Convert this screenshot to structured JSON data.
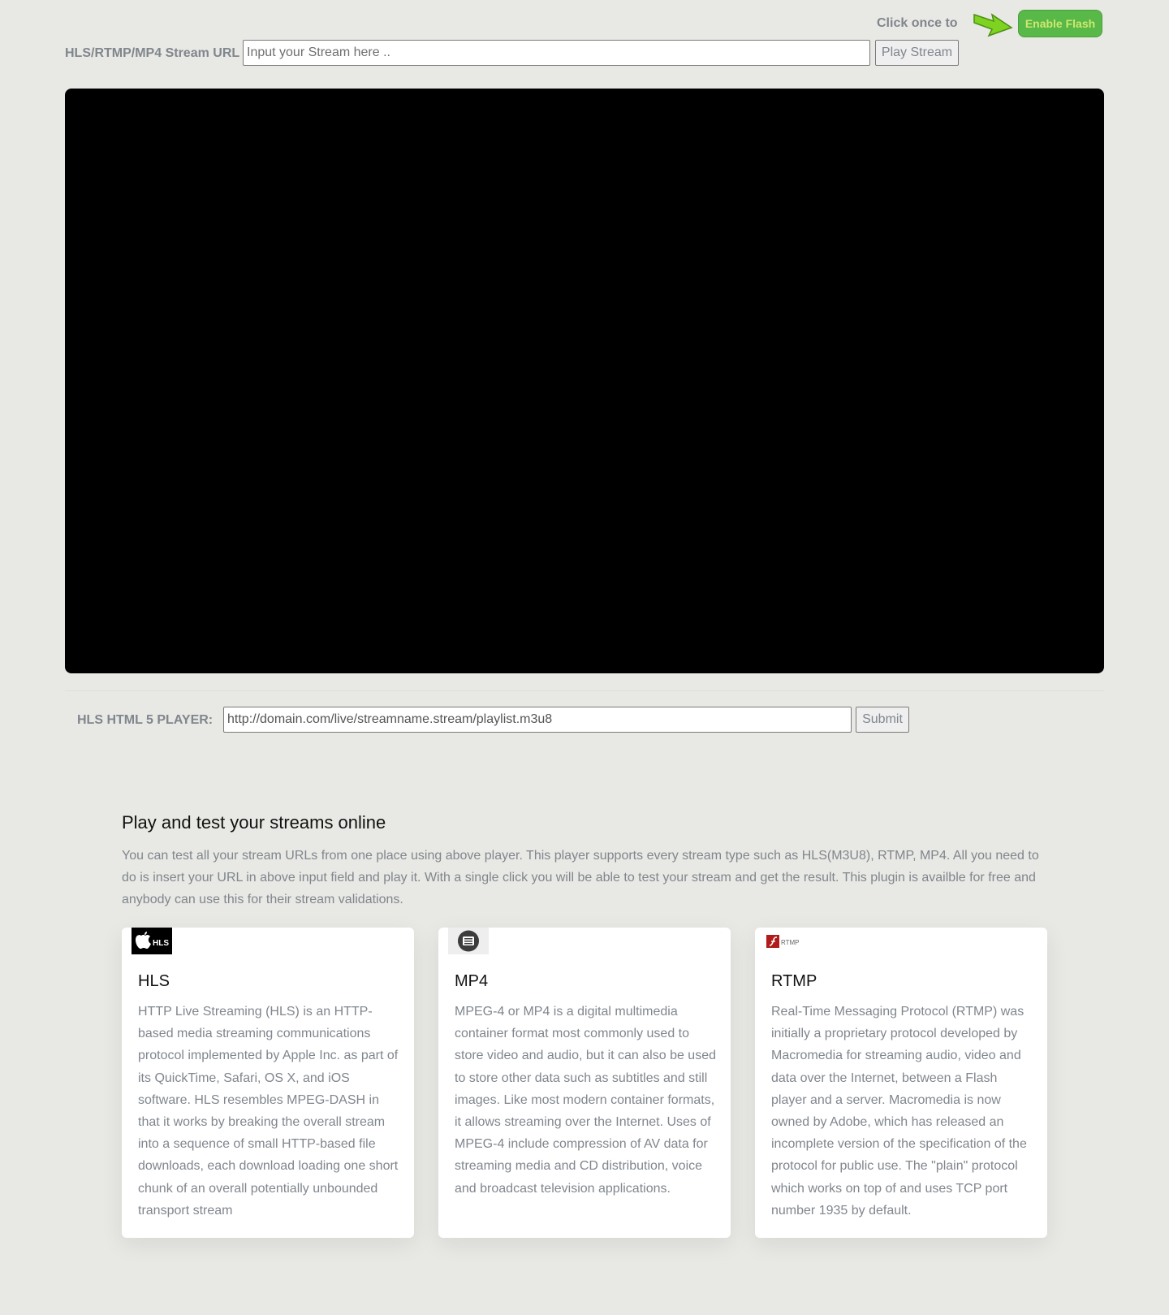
{
  "flash": {
    "prompt": "Click once to",
    "button_label": "Enable Flash",
    "arrow_icon": "arrow-right-icon"
  },
  "stream_form": {
    "label": "HLS/RTMP/MP4 Stream URL",
    "placeholder": "Input your Stream here ..",
    "button_label": "Play Stream"
  },
  "hls_form": {
    "label": "HLS HTML 5 PLAYER:",
    "value": "http://domain.com/live/streamname.stream/playlist.m3u8",
    "button_label": "Submit"
  },
  "intro": {
    "title": "Play and test your streams online",
    "text": "You can test all your stream URLs from one place using above player. This player supports every stream type such as HLS(M3U8), RTMP, MP4. All you need to do is insert your URL in above input field and play it. With a single click you will be able to test your stream and get the result. This plugin is availble for free and anybody can use this for their stream validations."
  },
  "cards": [
    {
      "logo": "hls-logo-icon",
      "logo_text": "HLS",
      "title": "HLS",
      "text": "HTTP Live Streaming (HLS) is an HTTP-based media streaming communications protocol implemented by Apple Inc. as part of its QuickTime, Safari, OS X, and iOS software. HLS resembles MPEG-DASH in that it works by breaking the overall stream into a sequence of small HTTP-based file downloads, each download loading one short chunk of an overall potentially unbounded transport stream"
    },
    {
      "logo": "mp4-logo-icon",
      "title": "MP4",
      "text": "MPEG-4 or MP4 is a digital multimedia container format most commonly used to store video and audio, but it can also be used to store other data such as subtitles and still images. Like most modern container formats, it allows streaming over the Internet. Uses of MPEG-4 include compression of AV data for streaming media and CD distribution, voice and broadcast television applications."
    },
    {
      "logo": "rtmp-logo-icon",
      "logo_text": "RTMP",
      "title": "RTMP",
      "text": "Real-Time Messaging Protocol (RTMP) was initially a proprietary protocol developed by Macromedia for streaming audio, video and data over the Internet, between a Flash player and a server. Macromedia is now owned by Adobe, which has released an incomplete version of the specification of the protocol for public use. The \"plain\" protocol which works on top of and uses TCP port number 1935 by default."
    }
  ],
  "colors": {
    "background": "#e8e8e4",
    "accent_green": "#58b848",
    "muted_text": "#80868d"
  }
}
